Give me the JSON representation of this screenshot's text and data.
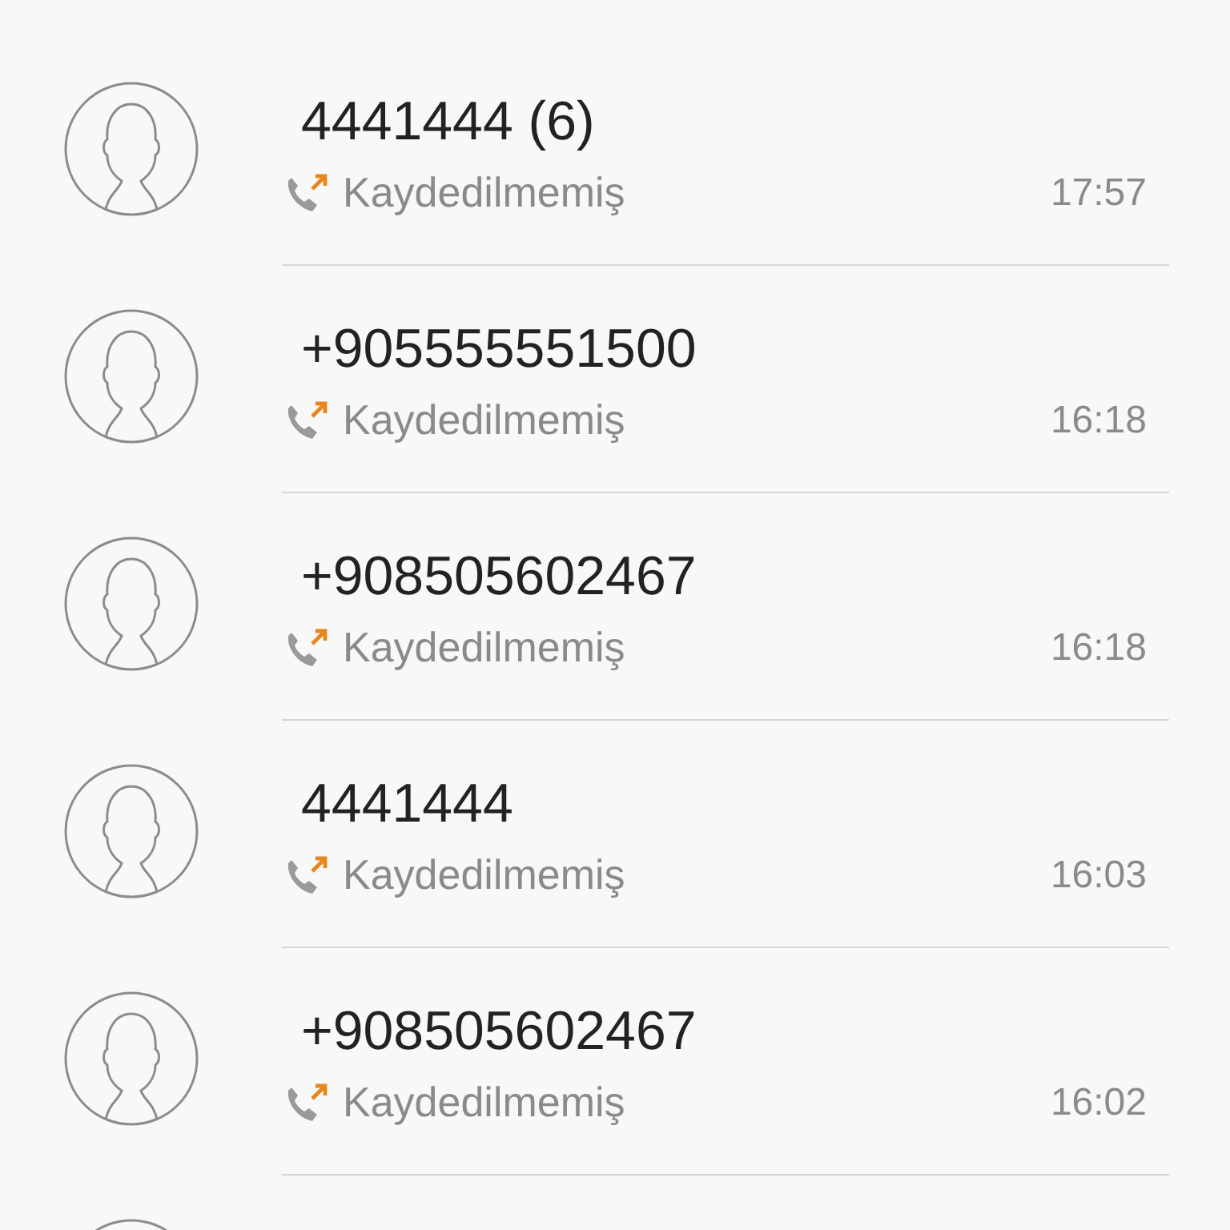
{
  "calls": [
    {
      "kind": "call",
      "number": "4441444 (6)",
      "label": "Kaydedilmemiş",
      "time": "17:57"
    },
    {
      "kind": "call",
      "number": "+905555551500",
      "label": "Kaydedilmemiş",
      "time": "16:18"
    },
    {
      "kind": "call",
      "number": "+908505602467",
      "label": "Kaydedilmemiş",
      "time": "16:18"
    },
    {
      "kind": "call",
      "number": "4441444",
      "label": "Kaydedilmemiş",
      "time": "16:03"
    },
    {
      "kind": "call",
      "number": "+908505602467",
      "label": "Kaydedilmemiş",
      "time": "16:02"
    },
    {
      "kind": "cut_off"
    }
  ]
}
